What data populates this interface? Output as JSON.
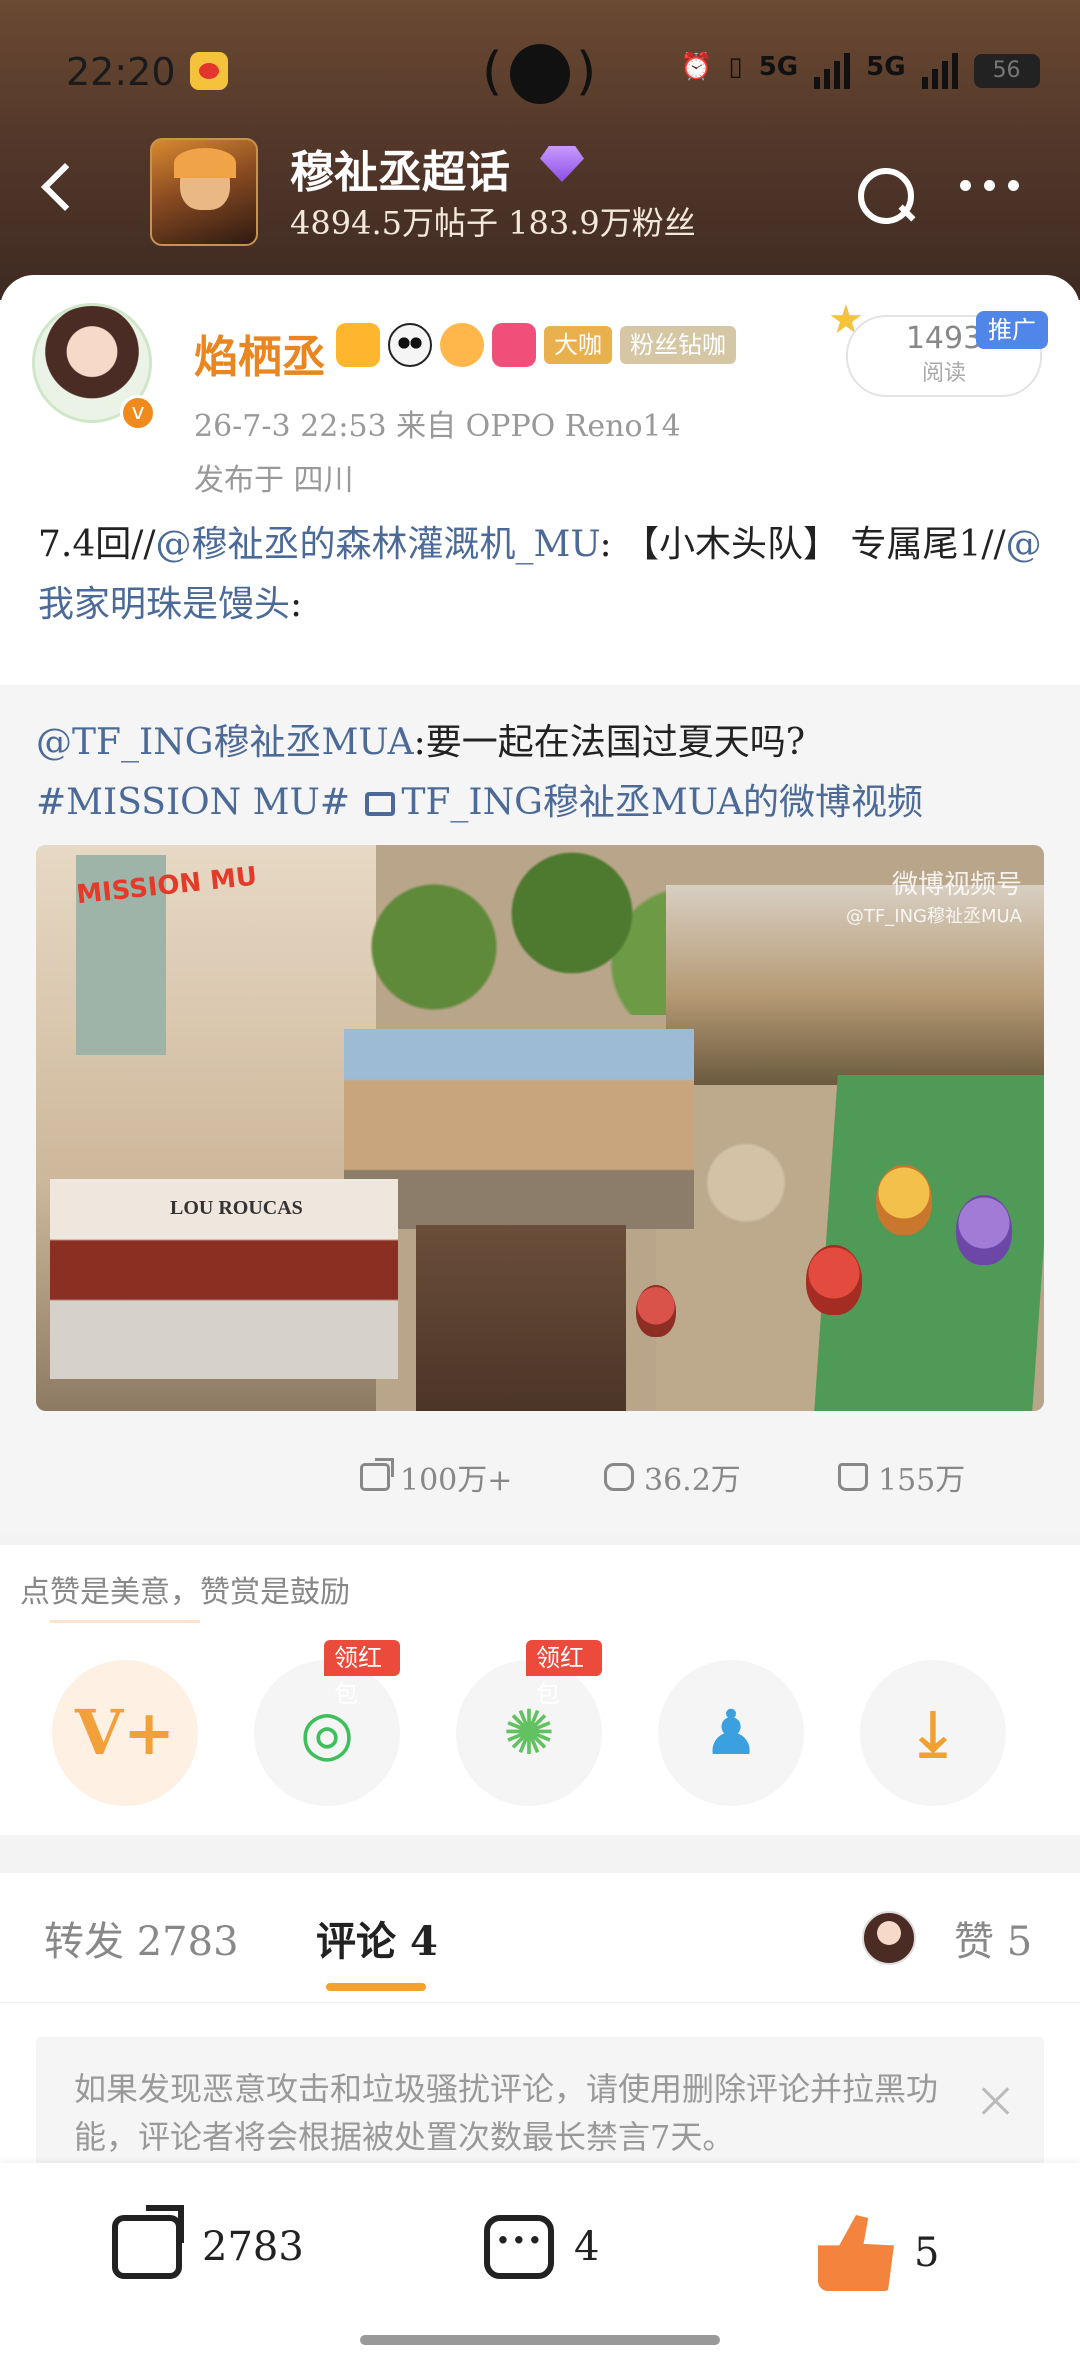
{
  "status_bar": {
    "time": "22:20",
    "signal_1": "5G",
    "signal_2": "5G",
    "battery": "56"
  },
  "header": {
    "topic_title": "穆祉丞超话",
    "topic_stats": "4894.5万帖子 183.9万粉丝"
  },
  "post": {
    "author_name": "焰栖丞",
    "tags": [
      "大咖",
      "粉丝钻咖"
    ],
    "meta": "26-7-3 22:53  来自 OPPO Reno14",
    "location": "发布于 四川",
    "read_count": "1493",
    "read_label": "阅读",
    "promo": "推广",
    "text_prefix": "7.4回//",
    "mention_1": "@穆祉丞的森林灌溉机_MU",
    "text_mid": ": 【小木头队】 专属尾1//",
    "mention_2": "@我家明珠是馒头",
    "text_suffix": ":"
  },
  "repost": {
    "mention": "@TF_ING穆祉丞MUA",
    "text": ":要一起在法国过夏天吗?",
    "hashtag": "#MISSION MU#",
    "video_link": "TF_ING穆祉丞MUA的微博视频",
    "media_logo": "MISSION MU",
    "watermark_line1": "微博视频号",
    "watermark_line2": "@TF_ING穆祉丞MUA",
    "shop_sign": "LOU ROUCAS"
  },
  "actions": {
    "share": "100万+",
    "comment": "36.2万",
    "like": "155万"
  },
  "reward": {
    "title": "点赞是美意，赞赏是鼓励",
    "hongbao_label": "领红包"
  },
  "tabs": {
    "repost_label": "转发",
    "repost_count": "2783",
    "comment_label": "评论",
    "comment_count": "4",
    "like_label": "赞",
    "like_count": "5"
  },
  "notice": {
    "text": "如果发现恶意攻击和垃圾骚扰评论，请使用删除评论并拉黑功能，评论者将会根据被处置次数最长禁言7天。"
  },
  "bottom_bar": {
    "repost_count": "2783",
    "comment_count": "4",
    "like_count": "5"
  },
  "colors": {
    "header_bg": "#54382a",
    "author_name": "#e9861f",
    "link": "#4c6a97",
    "accent": "#f5a12b",
    "hongbao": "#ec4a3a",
    "promo": "#4f86e8"
  }
}
